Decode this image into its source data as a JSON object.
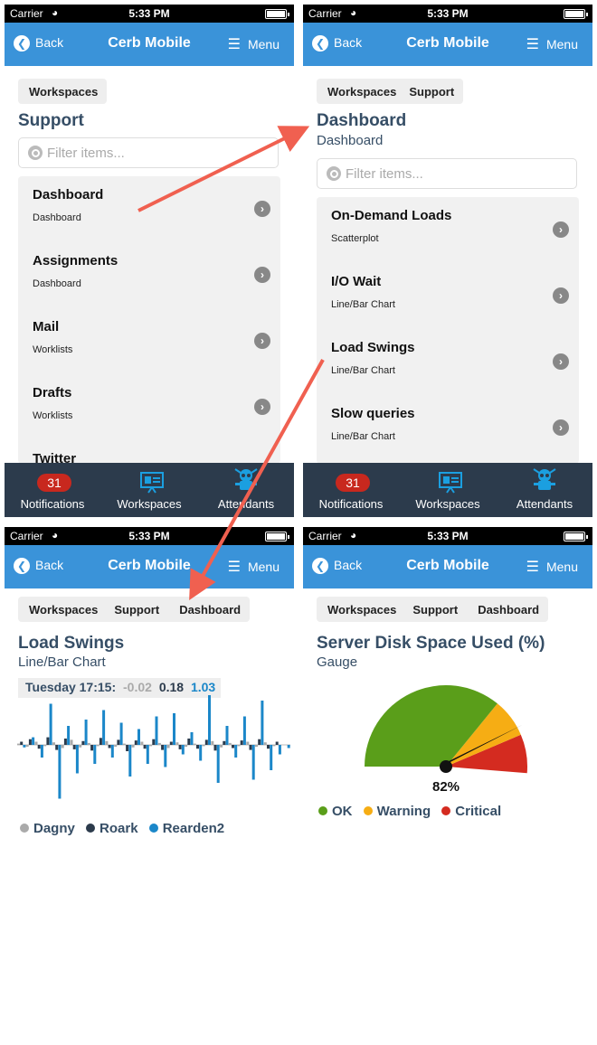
{
  "status": {
    "carrier": "Carrier",
    "time": "5:33 PM"
  },
  "nav": {
    "back": "Back",
    "title": "Cerb Mobile",
    "menu": "Menu"
  },
  "tabs": {
    "notifications": "Notifications",
    "notifications_count": "31",
    "workspaces": "Workspaces",
    "attendants": "Attendants"
  },
  "screen1": {
    "crumbs": [
      "Workspaces"
    ],
    "title": "Support",
    "filter_placeholder": "Filter items...",
    "items": [
      {
        "name": "Dashboard",
        "kind": "Dashboard"
      },
      {
        "name": "Assignments",
        "kind": "Dashboard"
      },
      {
        "name": "Mail",
        "kind": "Worklists"
      },
      {
        "name": "Drafts",
        "kind": "Worklists"
      },
      {
        "name": "Twitter",
        "kind": ""
      }
    ]
  },
  "screen2": {
    "crumbs": [
      "Workspaces",
      "Support"
    ],
    "title": "Dashboard",
    "subtitle": "Dashboard",
    "filter_placeholder": "Filter items...",
    "items": [
      {
        "name": "On-Demand Loads",
        "kind": "Scatterplot"
      },
      {
        "name": "I/O Wait",
        "kind": "Line/Bar Chart"
      },
      {
        "name": "Load Swings",
        "kind": "Line/Bar Chart"
      },
      {
        "name": "Slow queries",
        "kind": "Line/Bar Chart"
      }
    ]
  },
  "screen3": {
    "crumbs": [
      "Workspaces",
      "Support",
      "Dashboard"
    ],
    "title": "Load Swings",
    "subtitle": "Line/Bar Chart",
    "tooltip": {
      "label": "Tuesday 17:15:",
      "v1": "-0.02",
      "v2": "0.18",
      "v3": "1.03"
    },
    "legend": [
      "Dagny",
      "Roark",
      "Rearden2"
    ]
  },
  "screen4": {
    "crumbs": [
      "Workspaces",
      "Support",
      "Dashboard"
    ],
    "title": "Server Disk Space Used (%)",
    "subtitle": "Gauge",
    "gauge_label": "82%",
    "legend": [
      "OK",
      "Warning",
      "Critical"
    ]
  },
  "colors": {
    "nav": "#3a93d9",
    "tabbar": "#2c3b4c",
    "heading": "#364e66",
    "badge": "#c8281e",
    "dagny": "#aaaaaa",
    "roark": "#2c3b4c",
    "rearden": "#1b87c9",
    "ok": "#5a9e1a",
    "warning": "#f6ad14",
    "critical": "#d42b20",
    "arrow": "#f06050"
  },
  "chart_data": [
    {
      "type": "bar",
      "series": [
        {
          "name": "Dagny",
          "values": [
            0.02,
            -0.03,
            0.05,
            -0.02,
            0.04,
            -0.05,
            0.08,
            -0.04,
            0.03,
            -0.02,
            0.06,
            -0.03,
            0.02,
            -0.04,
            0.05,
            -0.02,
            0.03,
            -0.05,
            0.04,
            -0.03,
            0.02,
            -0.02,
            0.06,
            -0.04,
            0.03,
            -0.02,
            0.05,
            -0.03,
            0.04,
            -0.02
          ]
        },
        {
          "name": "Roark",
          "values": [
            0.05,
            0.09,
            -0.06,
            0.12,
            -0.08,
            0.1,
            -0.07,
            0.06,
            -0.09,
            0.11,
            -0.05,
            0.08,
            -0.1,
            0.07,
            -0.06,
            0.09,
            -0.08,
            0.05,
            -0.07,
            0.1,
            -0.06,
            0.08,
            -0.09,
            0.06,
            -0.05,
            0.07,
            -0.08,
            0.09,
            -0.06,
            0.05
          ]
        },
        {
          "name": "Rearden2",
          "values": [
            -0.04,
            0.12,
            -0.2,
            0.65,
            -0.85,
            0.3,
            -0.45,
            0.4,
            -0.3,
            0.55,
            -0.2,
            0.35,
            -0.5,
            0.25,
            -0.3,
            0.45,
            -0.35,
            0.5,
            -0.15,
            0.2,
            -0.25,
            0.8,
            -0.6,
            0.3,
            -0.2,
            0.45,
            -0.55,
            0.7,
            -0.4,
            -0.15,
            -0.05
          ]
        }
      ],
      "tooltip": {
        "x": "Tuesday 17:15",
        "values": [
          -0.02,
          0.18,
          1.03
        ]
      }
    },
    {
      "type": "gauge",
      "value": 82,
      "unit": "%",
      "bands": [
        {
          "name": "OK",
          "from": 0,
          "to": 70
        },
        {
          "name": "Warning",
          "from": 70,
          "to": 85
        },
        {
          "name": "Critical",
          "from": 85,
          "to": 100
        }
      ]
    }
  ]
}
